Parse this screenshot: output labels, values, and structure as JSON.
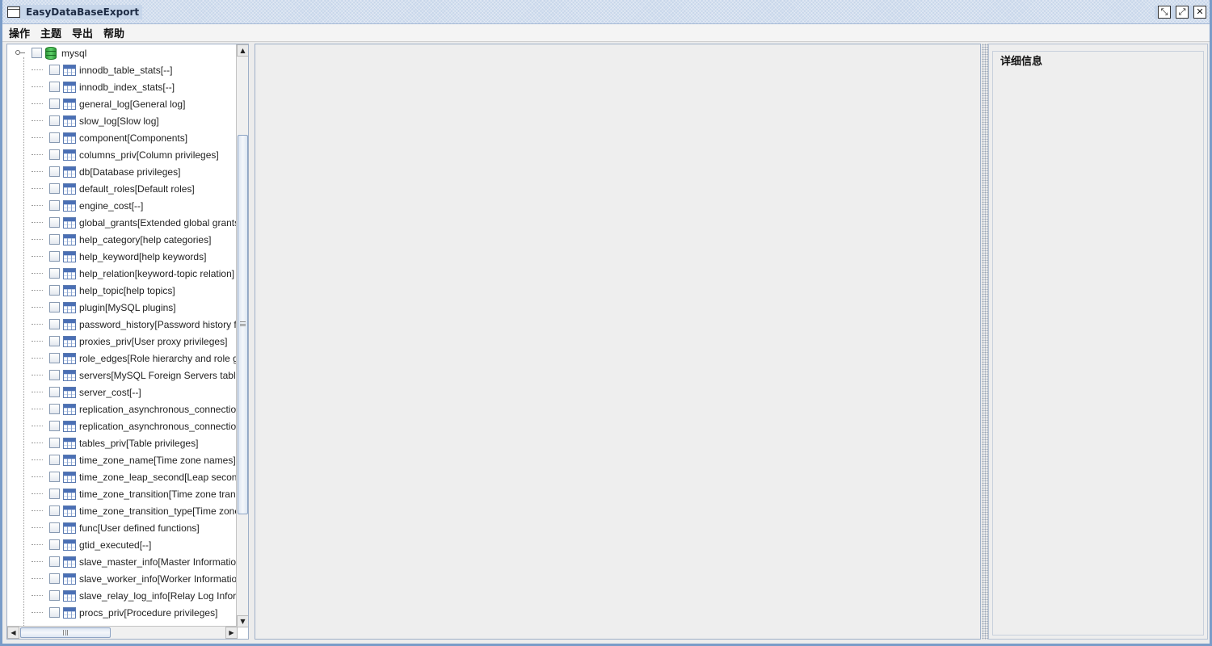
{
  "window": {
    "title": "EasyDataBaseExport",
    "buttons": {
      "minimize": "⤡",
      "maximize": "⤢",
      "close": "✕"
    }
  },
  "menu": [
    "操作",
    "主题",
    "导出",
    "帮助"
  ],
  "tree": {
    "root": {
      "label": "mysql",
      "icon": "database-icon",
      "checked": false
    },
    "items": [
      "innodb_table_stats[--]",
      "innodb_index_stats[--]",
      "general_log[General log]",
      "slow_log[Slow log]",
      "component[Components]",
      "columns_priv[Column privileges]",
      "db[Database privileges]",
      "default_roles[Default roles]",
      "engine_cost[--]",
      "global_grants[Extended global grants]",
      "help_category[help categories]",
      "help_keyword[help keywords]",
      "help_relation[keyword-topic relation]",
      "help_topic[help topics]",
      "plugin[MySQL plugins]",
      "password_history[Password history f",
      "proxies_priv[User proxy privileges]",
      "role_edges[Role hierarchy and role g",
      "servers[MySQL Foreign Servers table",
      "server_cost[--]",
      "replication_asynchronous_connectio",
      "replication_asynchronous_connectio",
      "tables_priv[Table privileges]",
      "time_zone_name[Time zone names]",
      "time_zone_leap_second[Leap secon",
      "time_zone_transition[Time zone tran",
      "time_zone_transition_type[Time zone",
      "func[User defined functions]",
      "gtid_executed[--]",
      "slave_master_info[Master Informatio",
      "slave_worker_info[Worker Informatio",
      "slave_relay_log_info[Relay Log Infor",
      "procs_priv[Procedure privileges]"
    ]
  },
  "detail": {
    "title": "详细信息"
  },
  "colors": {
    "accent": "#7a9cc8",
    "titlebar": "#c7d6ea",
    "panel": "#eeeeee"
  }
}
